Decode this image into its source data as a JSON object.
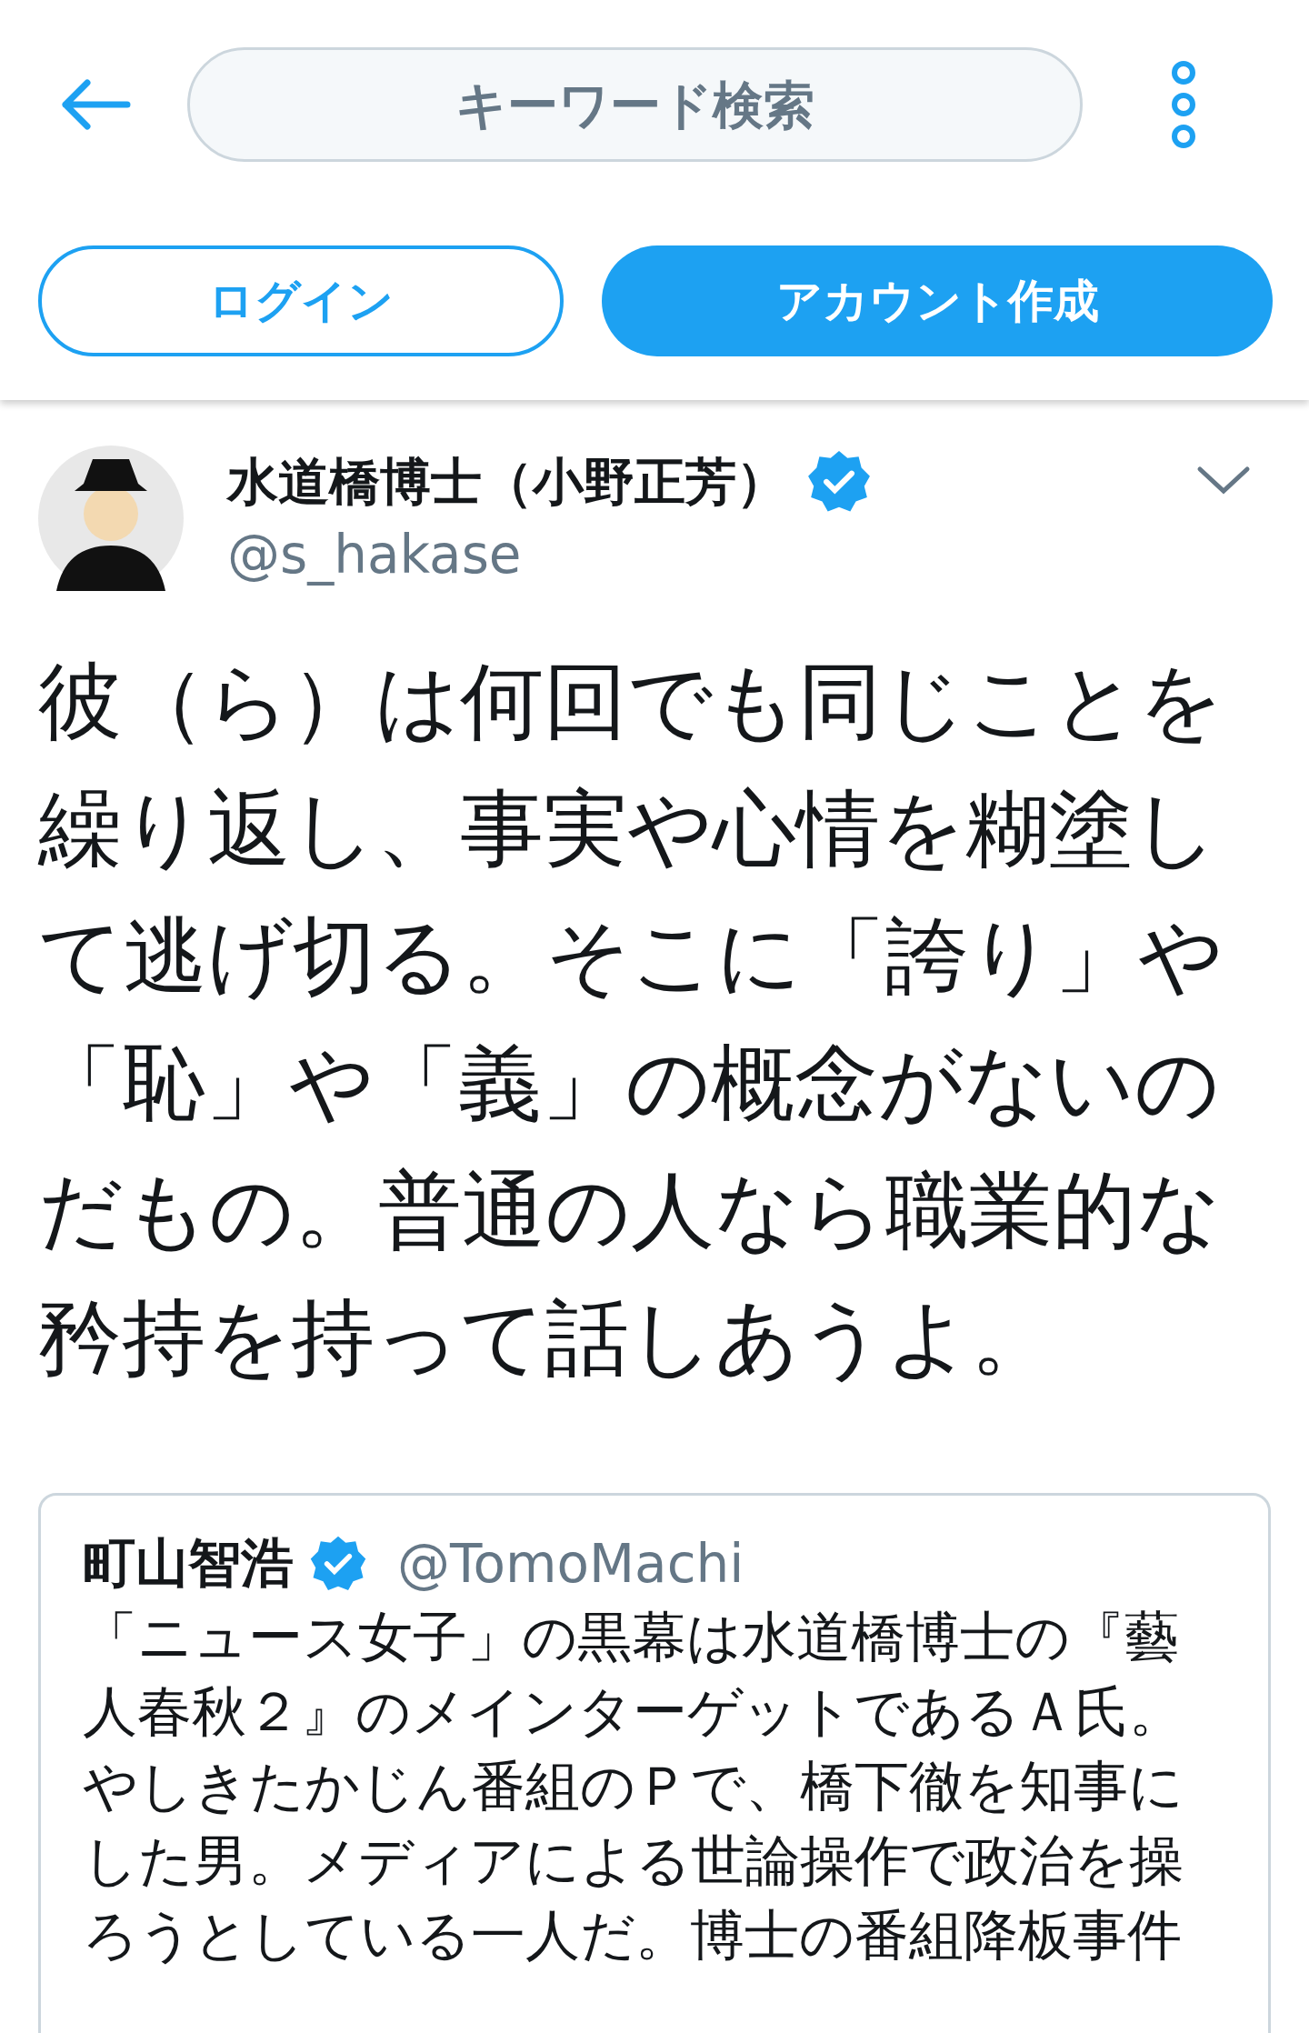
{
  "header": {
    "search": {
      "placeholder": "キーワード検索"
    },
    "login_button": "ログイン",
    "signup_button": "アカウント作成"
  },
  "tweet": {
    "name": "水道橋博士（小野正芳）",
    "verified": true,
    "handle": "@s_hakase",
    "text": "彼（ら）は何回でも同じことを繰り返し、事実や心情を糊塗して逃げ切る。そこに「誇り」や「恥」や「義」の概念がないのだもの。普通の人なら職業的な矜持を持って話しあうよ。",
    "quote": {
      "name": "町山智浩",
      "verified": true,
      "handle": "@TomoMachi",
      "text": "「ニュース女子」の黒幕は水道橋博士の『藝人春秋２』のメインターゲットであるＡ氏。やしきたかじん番組のＰで、橋下徹を知事にした男。メディアによる世論操作で政治を操ろうとしている一人だ。博士の番組降板事件"
    }
  }
}
